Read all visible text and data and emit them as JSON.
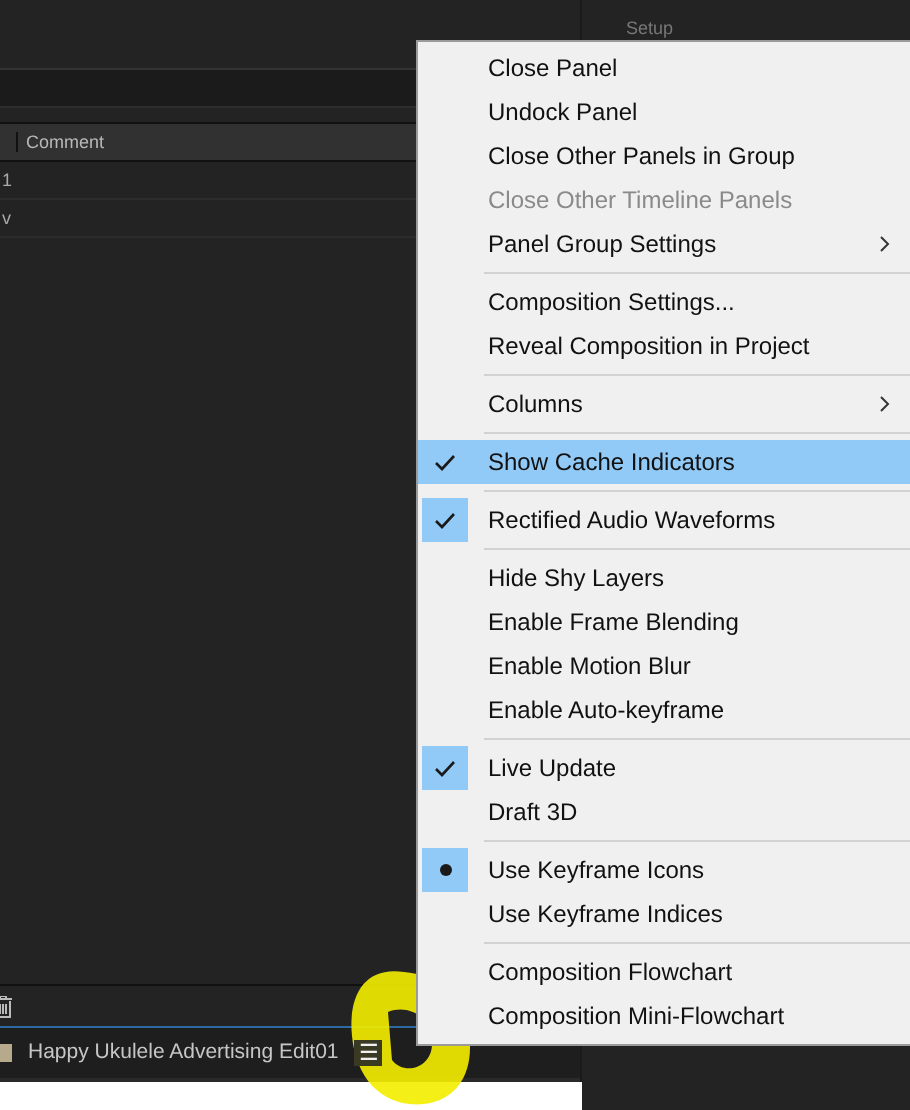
{
  "side_panel": {
    "heading": "Setup"
  },
  "timeline": {
    "columns": [
      "Comment"
    ],
    "rows": [
      {
        "cell": "1"
      },
      {
        "cell": "v"
      }
    ]
  },
  "tab": {
    "title": "Happy Ukulele Advertising Edit01",
    "menu_icon": "☰"
  },
  "menu": {
    "groups": [
      [
        {
          "label": "Close Panel",
          "kind": "command",
          "checked": false,
          "selected": false,
          "disabled": false
        },
        {
          "label": "Undock Panel",
          "kind": "command",
          "checked": false,
          "selected": false,
          "disabled": false
        },
        {
          "label": "Close Other Panels in Group",
          "kind": "command",
          "checked": false,
          "selected": false,
          "disabled": false
        },
        {
          "label": "Close Other Timeline Panels",
          "kind": "command",
          "checked": false,
          "selected": false,
          "disabled": true
        },
        {
          "label": "Panel Group Settings",
          "kind": "submenu",
          "checked": false,
          "selected": false,
          "disabled": false
        }
      ],
      [
        {
          "label": "Composition Settings...",
          "kind": "command",
          "checked": false,
          "selected": false,
          "disabled": false
        },
        {
          "label": "Reveal Composition in Project",
          "kind": "command",
          "checked": false,
          "selected": false,
          "disabled": false
        }
      ],
      [
        {
          "label": "Columns",
          "kind": "submenu",
          "checked": false,
          "selected": false,
          "disabled": false
        }
      ],
      [
        {
          "label": "Show Cache Indicators",
          "kind": "toggle",
          "checked": true,
          "selected": true,
          "disabled": false
        }
      ],
      [
        {
          "label": "Rectified Audio Waveforms",
          "kind": "toggle",
          "checked": true,
          "selected": false,
          "disabled": false
        }
      ],
      [
        {
          "label": "Hide Shy Layers",
          "kind": "toggle",
          "checked": false,
          "selected": false,
          "disabled": false
        },
        {
          "label": "Enable Frame Blending",
          "kind": "toggle",
          "checked": false,
          "selected": false,
          "disabled": false
        },
        {
          "label": "Enable Motion Blur",
          "kind": "toggle",
          "checked": false,
          "selected": false,
          "disabled": false
        },
        {
          "label": "Enable Auto-keyframe",
          "kind": "toggle",
          "checked": false,
          "selected": false,
          "disabled": false
        }
      ],
      [
        {
          "label": "Live Update",
          "kind": "toggle",
          "checked": true,
          "selected": false,
          "disabled": false
        },
        {
          "label": "Draft 3D",
          "kind": "toggle",
          "checked": false,
          "selected": false,
          "disabled": false
        }
      ],
      [
        {
          "label": "Use Keyframe Icons",
          "kind": "radio",
          "checked": true,
          "selected": false,
          "disabled": false
        },
        {
          "label": "Use Keyframe Indices",
          "kind": "radio",
          "checked": false,
          "selected": false,
          "disabled": false
        }
      ],
      [
        {
          "label": "Composition Flowchart",
          "kind": "command",
          "checked": false,
          "selected": false,
          "disabled": false
        },
        {
          "label": "Composition Mini-Flowchart",
          "kind": "command",
          "checked": false,
          "selected": false,
          "disabled": false
        }
      ]
    ]
  }
}
